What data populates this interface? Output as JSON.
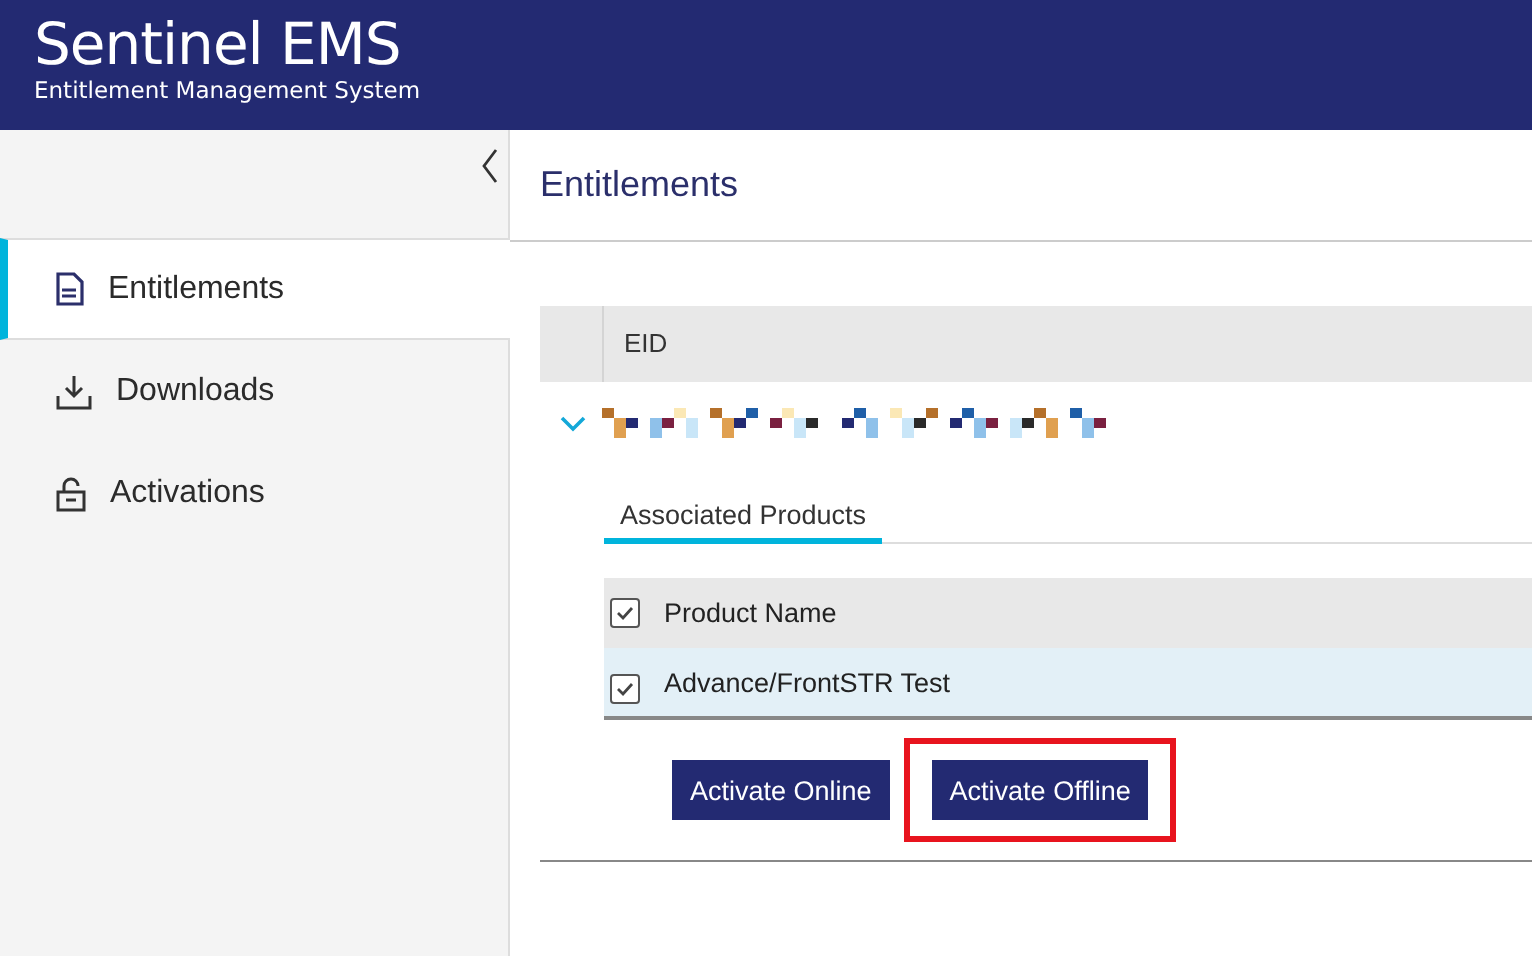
{
  "header": {
    "title": "Sentinel EMS",
    "subtitle": "Entitlement Management System"
  },
  "sidebar": {
    "items": [
      {
        "label": "Entitlements",
        "selected": true
      },
      {
        "label": "Downloads",
        "selected": false
      },
      {
        "label": "Activations",
        "selected": false
      }
    ]
  },
  "page_title": "Entitlements",
  "entitlements_table": {
    "columns": [
      "EID"
    ],
    "rows": [
      {
        "expanded": true,
        "eid": {
          "kind": "redacted"
        }
      }
    ]
  },
  "tabs": [
    {
      "label": "Associated Products",
      "selected": true
    }
  ],
  "products_table": {
    "header": {
      "label": "Product Name",
      "checked": true
    },
    "rows": [
      {
        "name": "Advance/FrontSTR Test",
        "checked": true
      }
    ]
  },
  "buttons": [
    {
      "label": "Activate Online",
      "highlighted": false
    },
    {
      "label": "Activate Offline",
      "highlighted": true
    }
  ]
}
